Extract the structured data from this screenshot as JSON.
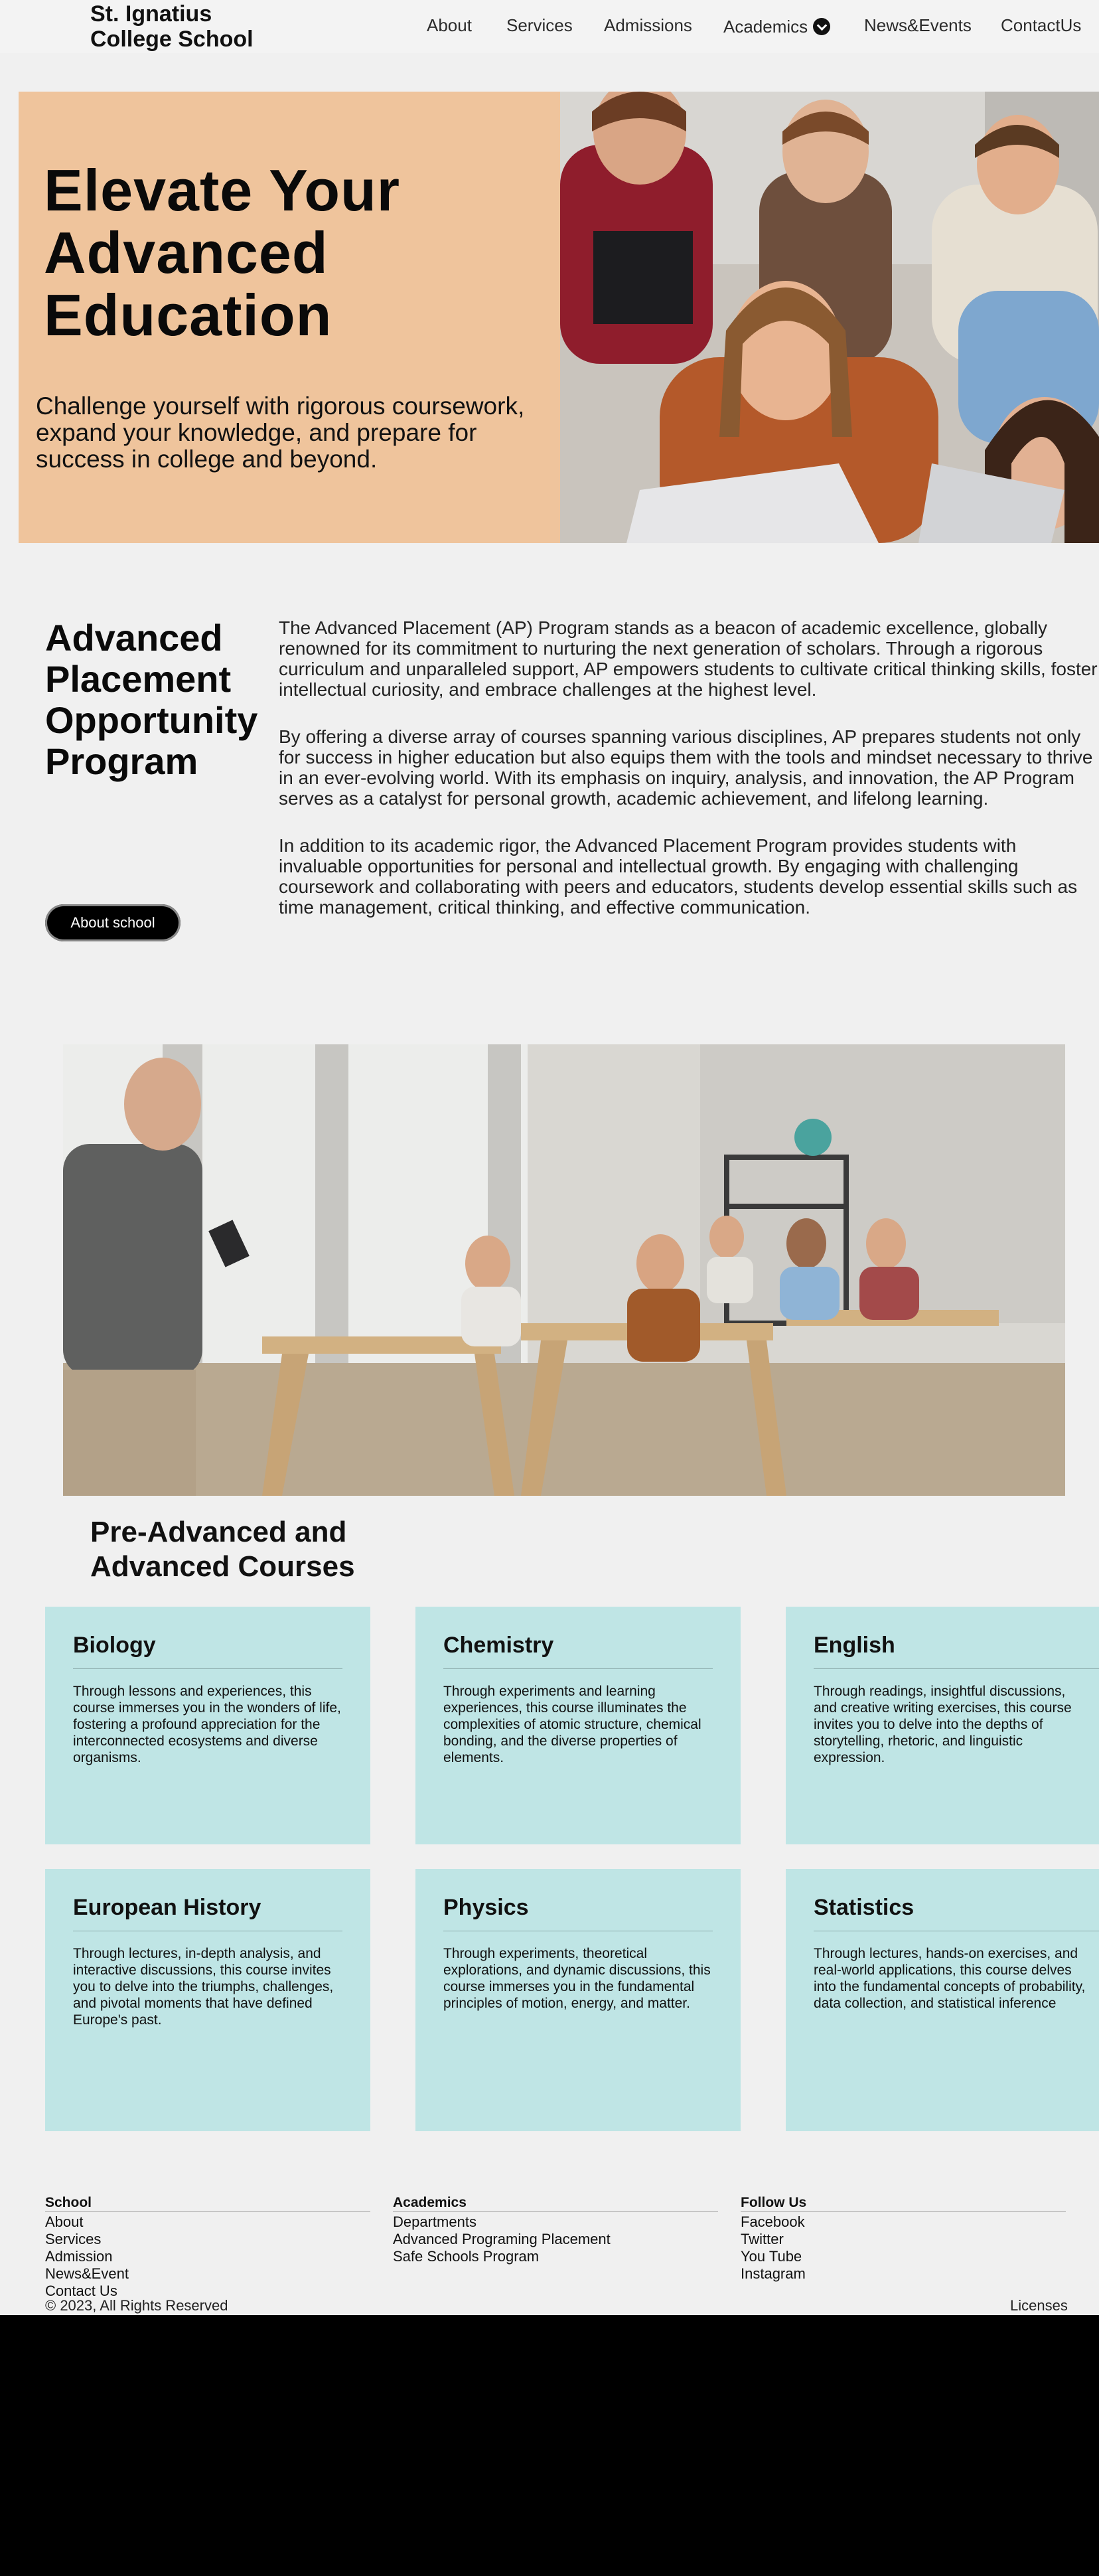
{
  "header": {
    "brand": "St. Ignatius College School",
    "nav": [
      "About",
      "Services",
      "Admissions",
      "Academics",
      "News&Events",
      "ContactUs"
    ]
  },
  "hero": {
    "title": "Elevate Your Advanced Education",
    "subtitle": "Challenge yourself with rigorous coursework, expand your knowledge, and prepare for success in college and beyond."
  },
  "ap": {
    "title": "Advanced Placement Opportunity Program",
    "button": "About school",
    "paragraphs": [
      "The Advanced Placement (AP) Program stands as a beacon of academic excellence, globally renowned for its commitment to nurturing the next generation of scholars. Through a rigorous curriculum and unparalleled support, AP empowers students to cultivate critical thinking skills, foster intellectual curiosity, and embrace challenges at the highest level.",
      "By offering a diverse array of courses spanning various disciplines, AP prepares students not only for success in higher education but also equips them with the tools and mindset necessary to thrive in an ever-evolving world. With its emphasis on inquiry, analysis, and innovation, the AP Program serves as a catalyst for personal growth, academic achievement, and lifelong learning.",
      "In addition to its academic rigor, the Advanced Placement Program provides students with invaluable opportunities for personal and intellectual growth. By engaging with challenging coursework and collaborating with peers and educators, students develop essential skills such as time management, critical thinking, and effective communication."
    ]
  },
  "courses": {
    "title": "Pre-Advanced and Advanced Courses",
    "items": [
      {
        "name": "Biology",
        "desc": "Through lessons and experiences, this course immerses you in the wonders of life, fostering a profound appreciation for the interconnected ecosystems and diverse organisms."
      },
      {
        "name": "Chemistry",
        "desc": "Through experiments and learning experiences, this course illuminates the complexities of atomic structure, chemical bonding, and the diverse properties of elements."
      },
      {
        "name": "English",
        "desc": "Through readings, insightful discussions, and creative writing exercises, this course invites you to delve into the depths of storytelling, rhetoric, and linguistic expression."
      },
      {
        "name": "European History",
        "desc": "Through lectures, in-depth analysis, and interactive discussions, this course invites you to delve into the triumphs, challenges, and pivotal moments that have defined Europe's past."
      },
      {
        "name": "Physics",
        "desc": "Through experiments, theoretical explorations, and dynamic discussions, this course immerses you in the fundamental principles of motion, energy, and matter."
      },
      {
        "name": "Statistics",
        "desc": "Through lectures, hands-on exercises, and real-world applications, this course delves into the fundamental concepts of probability, data collection, and statistical inference"
      }
    ]
  },
  "footer": {
    "columns": [
      {
        "heading": "School",
        "links": [
          "About",
          "Services",
          "Admission",
          "News&Event",
          "Contact Us"
        ]
      },
      {
        "heading": "Academics",
        "links": [
          "Departments",
          "Advanced Programing Placement",
          "Safe Schools Program"
        ]
      },
      {
        "heading": "Follow Us",
        "links": [
          "Facebook",
          "Twitter",
          "You Tube",
          "Instagram"
        ]
      }
    ],
    "copyright": "© 2023, All Rights Reserved",
    "licenses": "Licenses"
  },
  "colors": {
    "hero_panel": "#efc49c",
    "course_card": "#bfe5e5",
    "page_bg": "#f0f0f0",
    "button_bg": "#000000"
  }
}
